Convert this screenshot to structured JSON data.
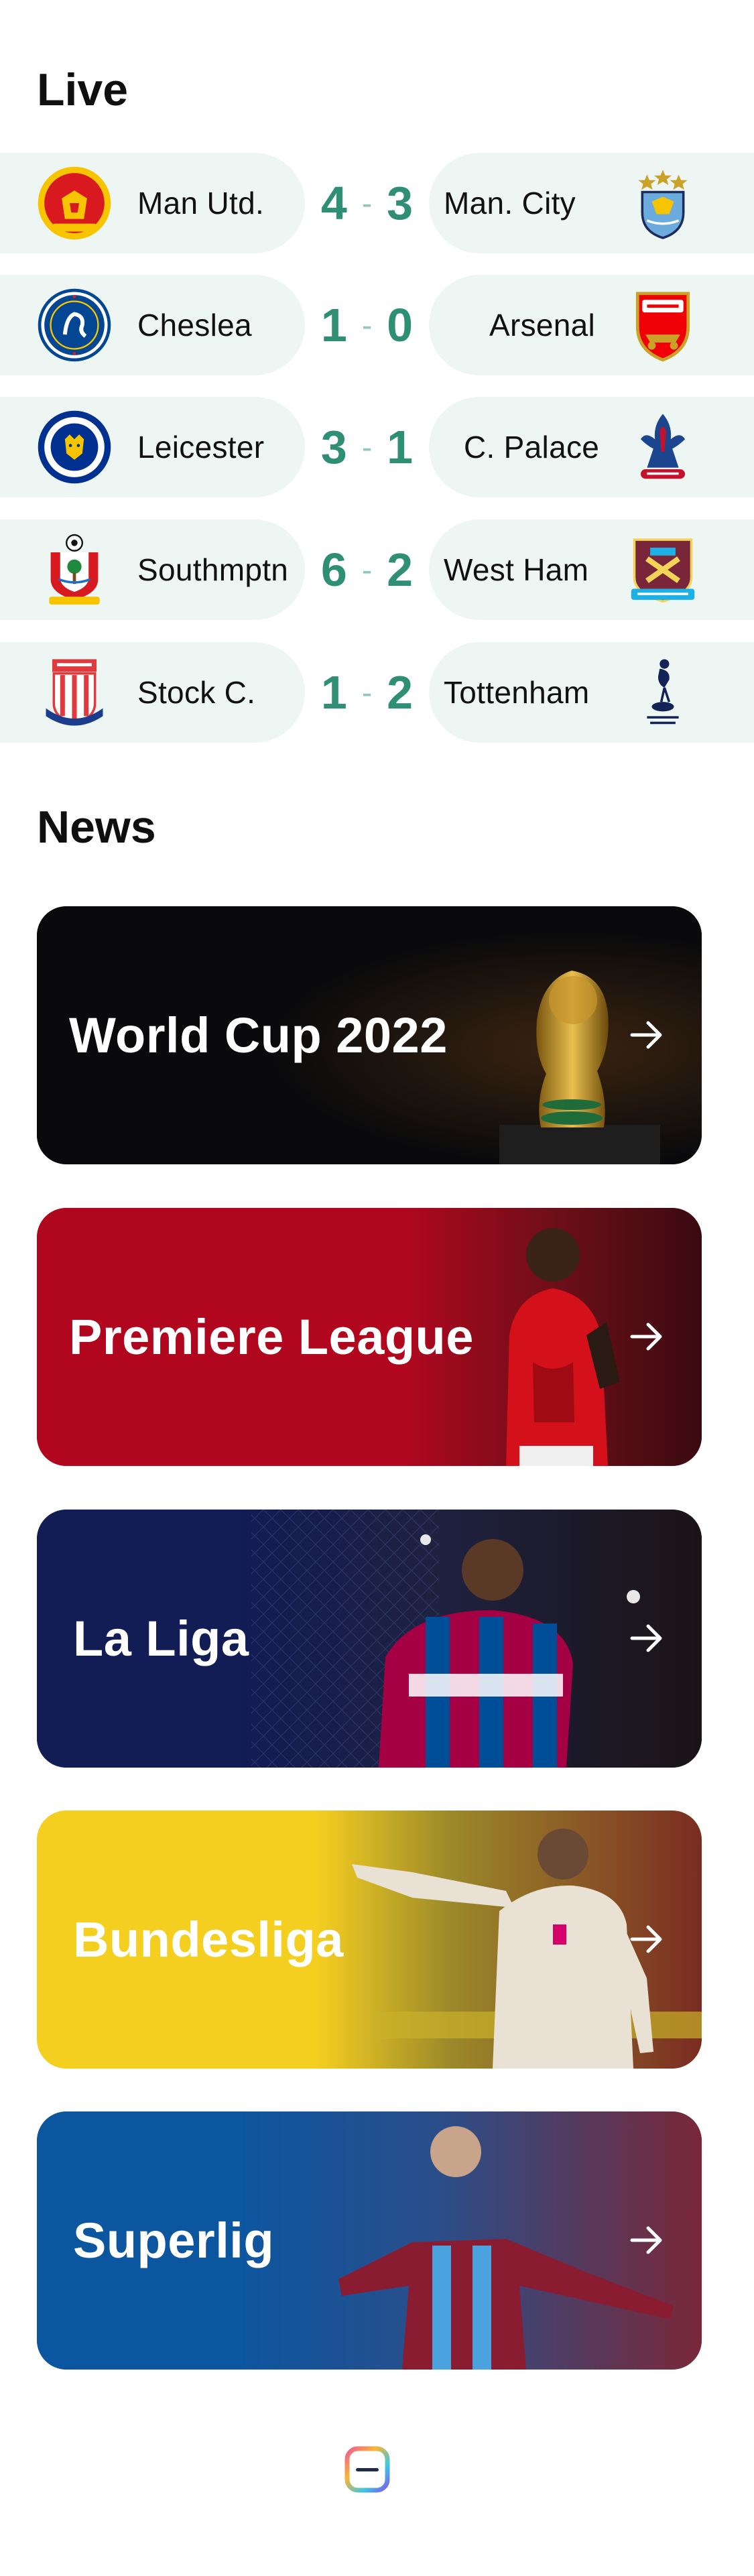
{
  "live": {
    "title": "Live",
    "matches": [
      {
        "home": "Man Utd.",
        "home_score": "4",
        "away_score": "3",
        "away": "Man. City",
        "home_badge": "man-utd-badge-icon",
        "away_badge": "man-city-badge-icon"
      },
      {
        "home": "Cheslea",
        "home_score": "1",
        "away_score": "0",
        "away": "Arsenal",
        "home_badge": "chelsea-badge-icon",
        "away_badge": "arsenal-badge-icon"
      },
      {
        "home": "Leicester",
        "home_score": "3",
        "away_score": "1",
        "away": "C. Palace",
        "home_badge": "leicester-badge-icon",
        "away_badge": "crystal-palace-badge-icon"
      },
      {
        "home": "Southmptn",
        "home_score": "6",
        "away_score": "2",
        "away": "West Ham",
        "home_badge": "southampton-badge-icon",
        "away_badge": "west-ham-badge-icon"
      },
      {
        "home": "Stock C.",
        "home_score": "1",
        "away_score": "2",
        "away": "Tottenham",
        "home_badge": "stoke-city-badge-icon",
        "away_badge": "tottenham-badge-icon"
      }
    ],
    "score_separator": "-"
  },
  "news": {
    "title": "News",
    "cards": [
      {
        "label": "World Cup 2022",
        "color": "#0a0a0c"
      },
      {
        "label": "Premiere League",
        "color": "#b0071f"
      },
      {
        "label": "La Liga",
        "color": "#121c55"
      },
      {
        "label": "Bundesliga",
        "color": "#f5cf20"
      },
      {
        "label": "Superlig",
        "color": "#0c56a0"
      }
    ]
  },
  "colors": {
    "accent": "#2f8f75",
    "pill_background": "#eef6f3"
  }
}
